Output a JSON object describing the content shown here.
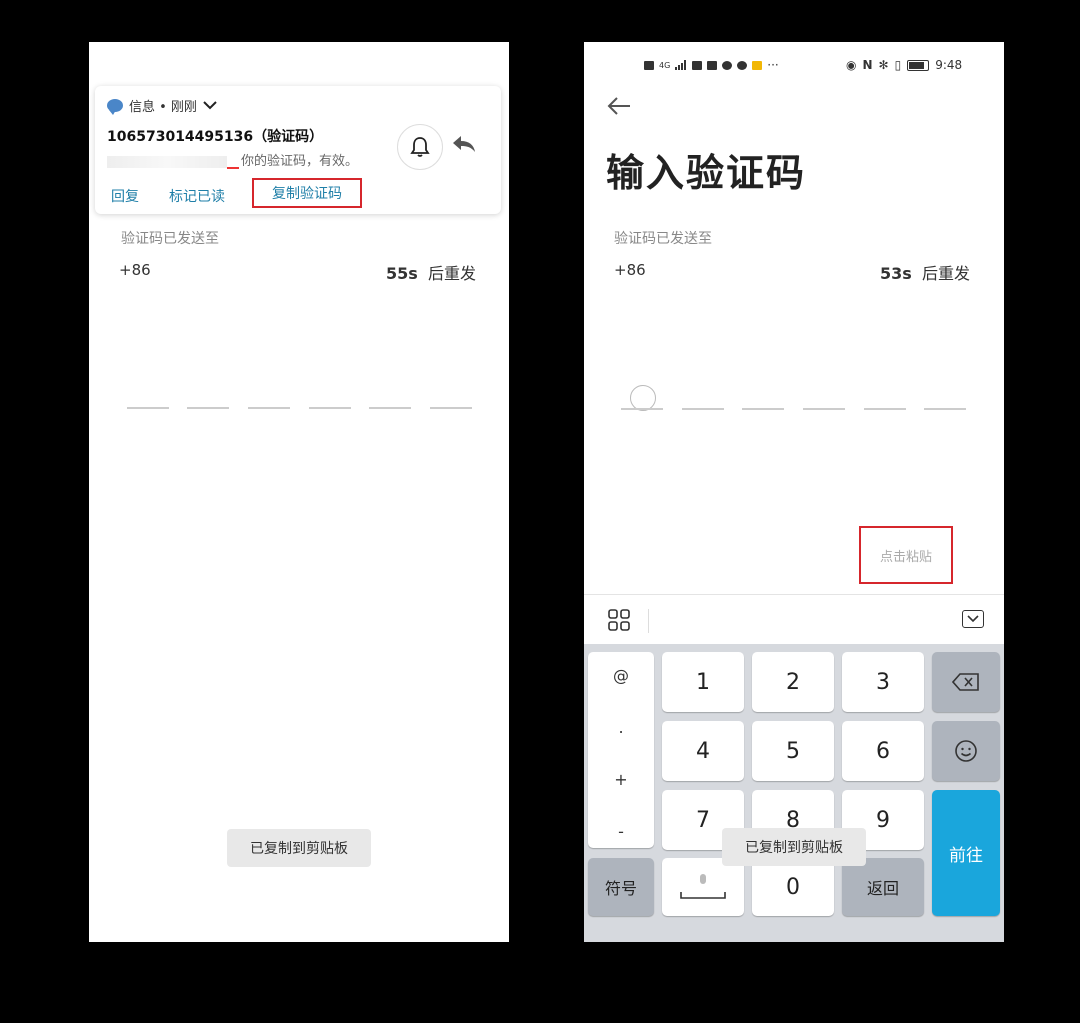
{
  "left": {
    "notification": {
      "app_label": "信息 • 刚刚",
      "sender": "106573014495136（验证码）",
      "body_suffix": "你的验证码，有效。",
      "actions": [
        "回复",
        "标记已读"
      ],
      "copy_code": "复制验证码"
    },
    "sent_to_label": "验证码已发送至",
    "country_code": "+86",
    "countdown_seconds": "55s",
    "countdown_suffix": "后重发",
    "toast": "已复制到剪贴板"
  },
  "right": {
    "status": {
      "network": "4G",
      "time": "9:48"
    },
    "title": "输入验证码",
    "sent_to_label": "验证码已发送至",
    "country_code": "+86",
    "countdown_seconds": "53s",
    "countdown_suffix": "后重发",
    "paste_tip": "点击粘贴",
    "keyboard": {
      "symbols": [
        "@",
        ".",
        "+",
        "-"
      ],
      "digits": [
        "1",
        "2",
        "3",
        "4",
        "5",
        "6",
        "7",
        "8",
        "9",
        "0"
      ],
      "symbol_key": "符号",
      "return_key": "返回",
      "go_key": "前往"
    },
    "toast": "已复制到剪贴板"
  },
  "colors": {
    "highlight_red": "#d6262c",
    "link_blue": "#1f7fa8",
    "go_blue": "#1aa6dc"
  }
}
